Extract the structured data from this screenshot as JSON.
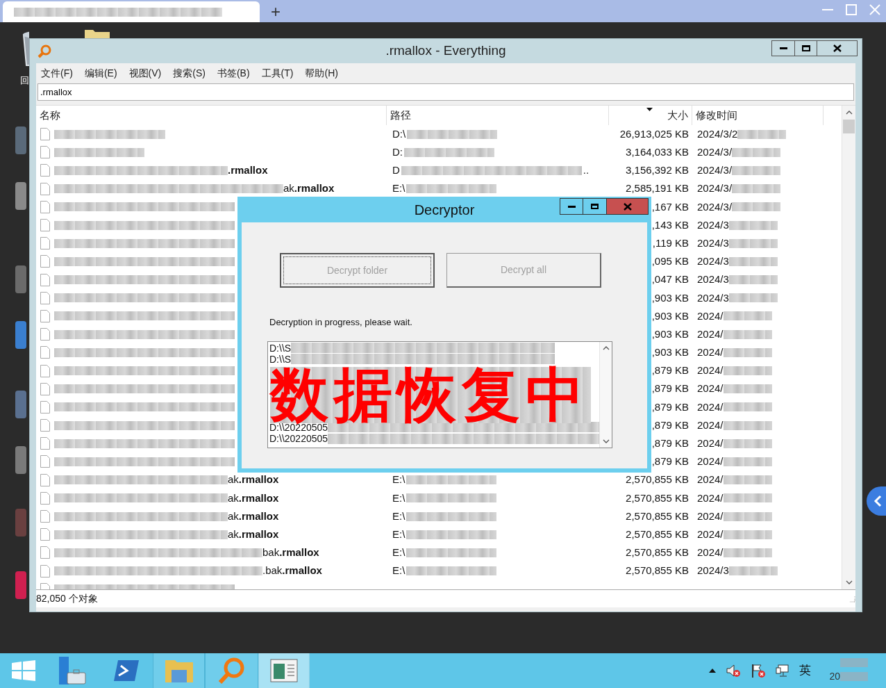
{
  "browser": {
    "new_tab": "+"
  },
  "desktop": {
    "icon_label": "回"
  },
  "window": {
    "title": ".rmallox - Everything",
    "menu": [
      "文件(F)",
      "编辑(E)",
      "视图(V)",
      "搜索(S)",
      "书签(B)",
      "工具(T)",
      "帮助(H)"
    ],
    "search": {
      "value": ".rmallox"
    },
    "columns": [
      {
        "label": "名称",
        "sorted": false
      },
      {
        "label": "路径",
        "sorted": false
      },
      {
        "label": "大小",
        "sorted": true
      },
      {
        "label": "修改时间",
        "sorted": false
      }
    ],
    "rows": [
      {
        "path": "D:\\",
        "size": "26,913,025 KB",
        "date": "2024/3/2"
      },
      {
        "path": "D:",
        "size": "3,164,033 KB",
        "date": "2024/3/"
      },
      {
        "name": "**.rmallox**",
        "path": "D",
        "path_tail": "..",
        "size": "3,156,392 KB",
        "date": "2024/3/"
      },
      {
        "name": "ak**.rmallox**",
        "path": "E:\\",
        "size": "2,585,191 KB",
        "date": "2024/3/"
      },
      {
        "size": ",167 KB",
        "date": "2024/3/"
      },
      {
        "size": ",143 KB",
        "date": "2024/3"
      },
      {
        "size": ",119 KB",
        "date": "2024/3"
      },
      {
        "size": ",095 KB",
        "date": "2024/3"
      },
      {
        "size": ",047 KB",
        "date": "2024/3"
      },
      {
        "size": ",903 KB",
        "date": "2024/3"
      },
      {
        "size": ",903 KB",
        "date": "2024/"
      },
      {
        "size": ",903 KB",
        "date": "2024/"
      },
      {
        "size": ",903 KB",
        "date": "2024/"
      },
      {
        "size": ",879 KB",
        "date": "2024/"
      },
      {
        "size": ",879 KB",
        "date": "2024/"
      },
      {
        "size": ",879 KB",
        "date": "2024/"
      },
      {
        "size": ",879 KB",
        "date": "2024/"
      },
      {
        "size": ",879 KB",
        "date": "2024/"
      },
      {
        "size": ",879 KB",
        "date": "2024/"
      },
      {
        "name": "ak**.rmallox**",
        "path": "E:\\",
        "size": "2,570,855 KB",
        "date": "2024/"
      },
      {
        "name": "ak**.rmallox**",
        "path": "E:\\",
        "size": "2,570,855 KB",
        "date": "2024/"
      },
      {
        "name": "ak**.rmallox**",
        "path": "E:\\",
        "size": "2,570,855 KB",
        "date": "2024/"
      },
      {
        "name": "ak**.rmallox**",
        "path": "E:\\",
        "size": "2,570,855 KB",
        "date": "2024/"
      },
      {
        "name": "bak**.rmallox**",
        "path": "E:\\",
        "size": "2,570,855 KB",
        "date": "2024/"
      },
      {
        "name": ".bak**.rmallox**",
        "path": "E:\\",
        "size": "2,570,855 KB",
        "date": "2024/3"
      }
    ],
    "status": "82,050 个对象"
  },
  "dialog": {
    "title": "Decryptor",
    "buttons": [
      {
        "label": "Decrypt folder",
        "focused": true,
        "disabled": true
      },
      {
        "label": "Decrypt all",
        "focused": false,
        "disabled": true
      }
    ],
    "message": "Decryption in progress, please wait.",
    "log": [
      {
        "kind": "text",
        "text": "D:\\\\S"
      },
      {
        "kind": "text",
        "text": "D:\\\\S"
      },
      {
        "kind": "obscured"
      },
      {
        "kind": "obscured"
      },
      {
        "kind": "obscured"
      },
      {
        "kind": "obscured"
      },
      {
        "kind": "obscured"
      },
      {
        "kind": "text",
        "text": "D:\\\\20220505"
      },
      {
        "kind": "text",
        "text": "D:\\\\20220505"
      }
    ],
    "overlay": "数据恢复中"
  },
  "taskbar": {
    "apps": [
      {
        "kind": "server",
        "selected": false
      },
      {
        "kind": "shell",
        "selected": false
      },
      {
        "kind": "folder",
        "selected": false
      },
      {
        "kind": "search",
        "selected": false
      },
      {
        "kind": "window",
        "selected": true
      }
    ],
    "language": "英",
    "clock": "20"
  }
}
